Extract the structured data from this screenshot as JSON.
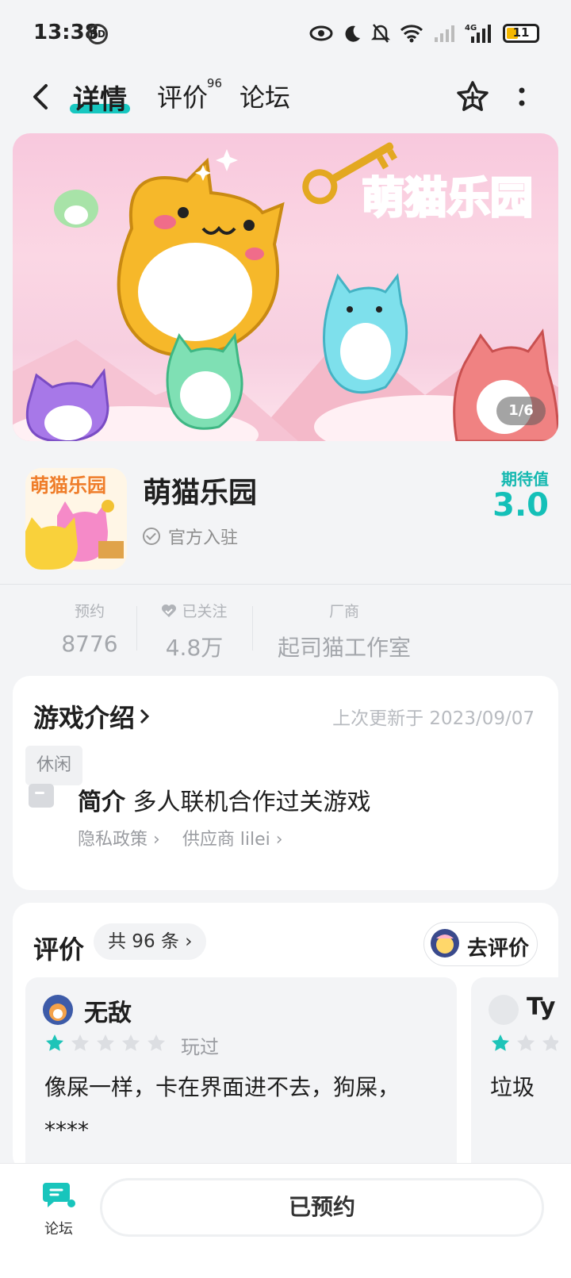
{
  "status_bar": {
    "time": "13:38",
    "battery": "11"
  },
  "nav": {
    "tabs": [
      {
        "label": "详情"
      },
      {
        "label": "评价",
        "badge": "96"
      },
      {
        "label": "论坛"
      }
    ]
  },
  "banner": {
    "title_art": "萌猫乐园",
    "pager": "1/6"
  },
  "app": {
    "name": "萌猫乐园",
    "icon_art": "萌猫乐园",
    "official": "官方入驻",
    "expect_label": "期待值",
    "expect_value": "3.0"
  },
  "stats": [
    {
      "label": "预约",
      "value": "8776"
    },
    {
      "label": "已关注",
      "value": "4.8万"
    },
    {
      "label": "厂商",
      "value": "起司猫工作室"
    }
  ],
  "intro": {
    "title": "游戏介绍",
    "updated": "上次更新于 2023/09/07",
    "tag": "休闲",
    "brief_label": "简介",
    "brief_text": "多人联机合作过关游戏",
    "privacy_link": "隐私政策",
    "supplier_link": "供应商 lilei"
  },
  "reviews": {
    "title": "评价",
    "count_label": "共 96 条",
    "go_review": "去评价",
    "items": [
      {
        "user": "无敌",
        "rating": 1,
        "status": "玩过",
        "text": "像屎一样，卡在界面进不去，狗屎，****"
      },
      {
        "user": "Ty",
        "rating": 1,
        "status": "",
        "text": "垃圾"
      }
    ]
  },
  "bottom": {
    "forum_label": "论坛",
    "cta_label": "已预约"
  },
  "colors": {
    "accent": "#14c0b8",
    "star": "#1ec4b8"
  }
}
